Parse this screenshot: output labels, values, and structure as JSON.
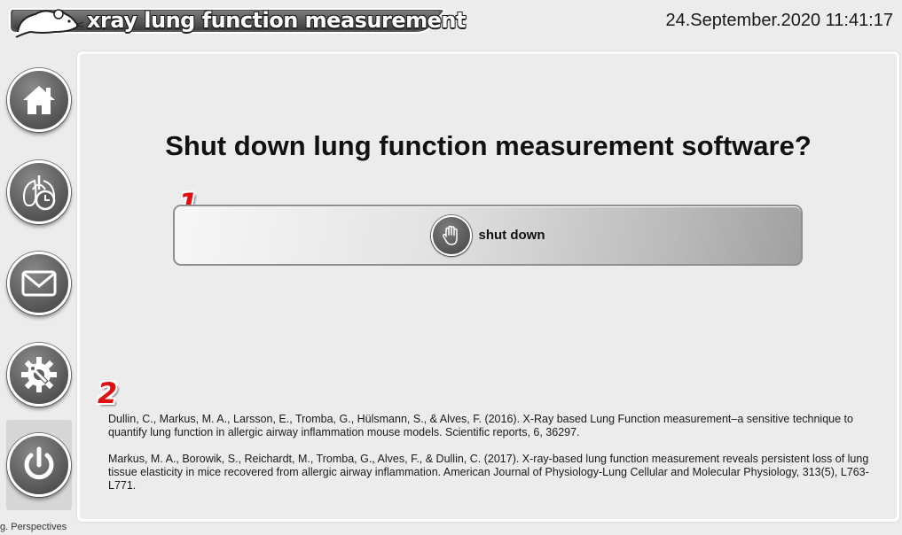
{
  "header": {
    "title": "xray lung function measurement",
    "datetime": "24.September.2020 11:41:17"
  },
  "sidebar": {
    "items": [
      {
        "name": "home",
        "icon": "home-icon",
        "active": false
      },
      {
        "name": "lung-measurement",
        "icon": "lung-clock-icon",
        "active": false
      },
      {
        "name": "mail",
        "icon": "envelope-icon",
        "active": false
      },
      {
        "name": "settings",
        "icon": "gear-wrench-icon",
        "active": false
      },
      {
        "name": "power",
        "icon": "power-icon",
        "active": true
      }
    ]
  },
  "main": {
    "prompt": "Shut down lung function measurement software?",
    "shutdown_button": {
      "label": "shut down",
      "icon": "hand-stop-icon"
    },
    "markers": [
      "1",
      "2"
    ],
    "references": [
      "Dullin, C., Markus, M. A., Larsson, E., Tromba, G., Hülsmann, S., & Alves, F. (2016). X-Ray based Lung Function measurement–a sensitive technique to quantify lung function in allergic airway inflammation mouse models. Scientific reports, 6, 36297.",
      "Markus, M. A., Borowik, S., Reichardt, M., Tromba, G., Alves, F., & Dullin, C. (2017). X-ray-based lung function measurement reveals persistent loss of lung tissue elasticity in mice recovered from allergic airway inflammation. American Journal of Physiology-Lung Cellular and Molecular Physiology, 313(5), L763-L771."
    ]
  },
  "footer": {
    "fragment": "g. Perspectives"
  },
  "colors": {
    "background": "#ececec",
    "marker_red": "#e01010",
    "icon_gray": "#5c5c5c"
  }
}
